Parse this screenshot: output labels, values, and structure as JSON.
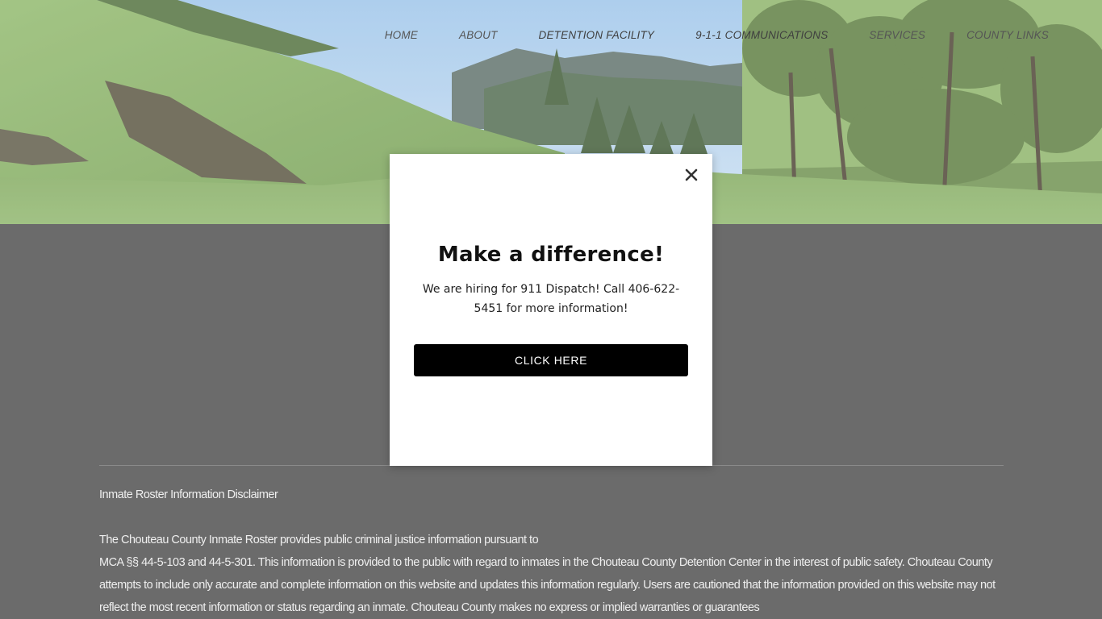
{
  "nav": {
    "items": [
      {
        "label": "HOME"
      },
      {
        "label": "ABOUT"
      },
      {
        "label": "DETENTION FACILITY"
      },
      {
        "label": "9-1-1 COMMUNICATIONS"
      },
      {
        "label": "SERVICES"
      },
      {
        "label": "COUNTY LINKS"
      }
    ]
  },
  "modal": {
    "title": "Make a difference!",
    "body": "We are hiring for 911 Dispatch!  Call 406-622-5451 for more information!",
    "button_label": "CLICK HERE",
    "close_icon": "close-icon"
  },
  "content": {
    "heading": "Inmate Roster Information Disclaimer",
    "paragraphs": [
      "The Chouteau County Inmate Roster provides public criminal justice information pursuant to",
      "MCA §§ 44-5-103 and 44-5-301.  This information is provided to the public with regard to inmates in the Chouteau County Detention Center in the interest of public safety.  Chouteau County attempts to include only accurate and complete information on this website and updates this information regularly.  Users are cautioned that the information provided on this website may not reflect the most recent information or status regarding an inmate.  Chouteau County makes no express or implied warranties or guarantees"
    ]
  },
  "colors": {
    "page_background": "#6b6b6b",
    "modal_background": "#ffffff",
    "button_background": "#000000",
    "button_text": "#ffffff",
    "content_text": "#efefef"
  }
}
